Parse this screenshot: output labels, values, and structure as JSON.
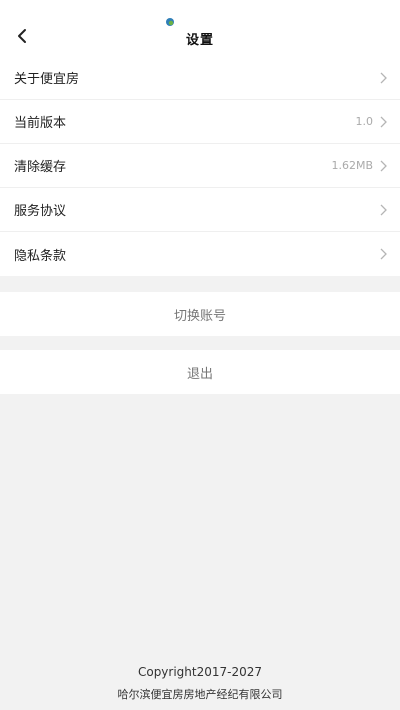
{
  "header": {
    "title": "设置",
    "back_icon": "chevron-left-icon"
  },
  "settings": {
    "items": [
      {
        "label": "关于便宜房",
        "value": ""
      },
      {
        "label": "当前版本",
        "value": "1.0"
      },
      {
        "label": "清除缓存",
        "value": "1.62MB"
      },
      {
        "label": "服务协议",
        "value": ""
      },
      {
        "label": "隐私条款",
        "value": ""
      }
    ]
  },
  "actions": {
    "switch_account": "切换账号",
    "logout": "退出"
  },
  "footer": {
    "copyright": "Copyright2017-2027",
    "company": "哈尔滨便宜房房地产经纪有限公司"
  }
}
